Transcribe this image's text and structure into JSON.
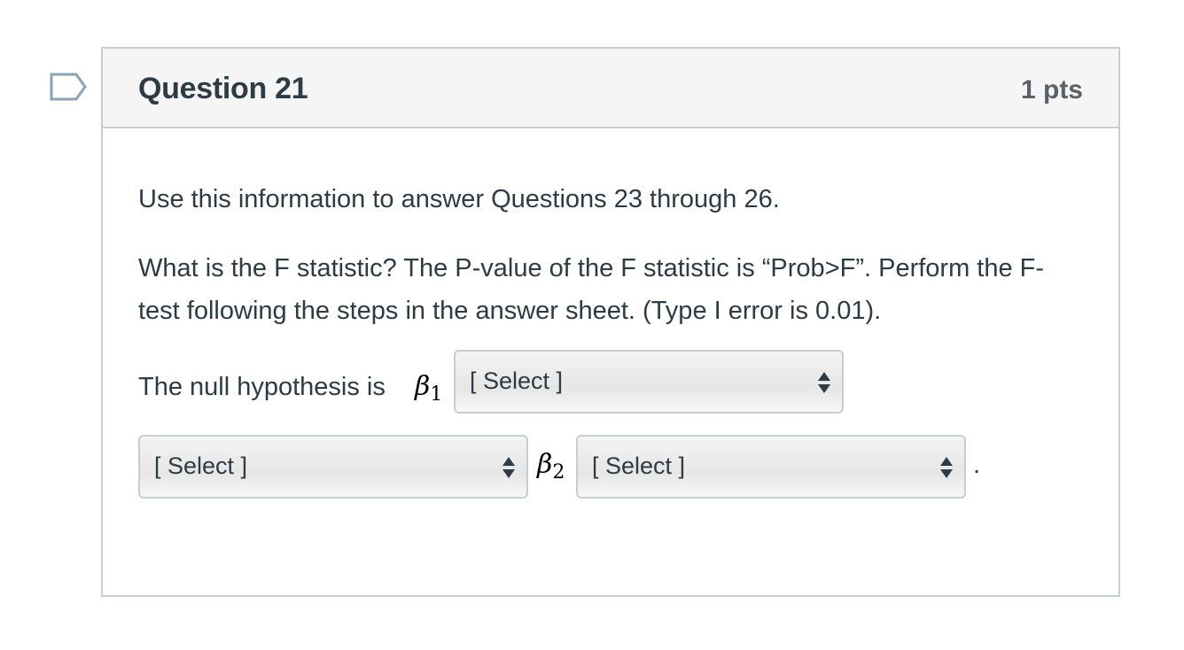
{
  "question": {
    "title": "Question 21",
    "points": "1 pts",
    "intro": "Use this information to answer Questions 23 through 26.",
    "body": "What is the F statistic? The P-value of the F statistic is “Prob>F”. Perform the F-test following the steps in the answer sheet. (Type I error is 0.01).",
    "hypothesis_label": "The null hypothesis is",
    "beta1": "β",
    "beta1_sub": "1",
    "beta2": "β",
    "beta2_sub": "2",
    "period": "."
  },
  "selects": [
    {
      "value": "[ Select ]"
    },
    {
      "value": "[ Select ]"
    },
    {
      "value": "[ Select ]"
    }
  ],
  "icons": {
    "flag": "bookmark-flag-icon",
    "select_arrows": "up-down-arrows-icon"
  },
  "colors": {
    "text": "#2d3b45",
    "border": "#c7cdd1",
    "header_bg": "#f5f5f5",
    "flag": "#8ca2b6"
  }
}
